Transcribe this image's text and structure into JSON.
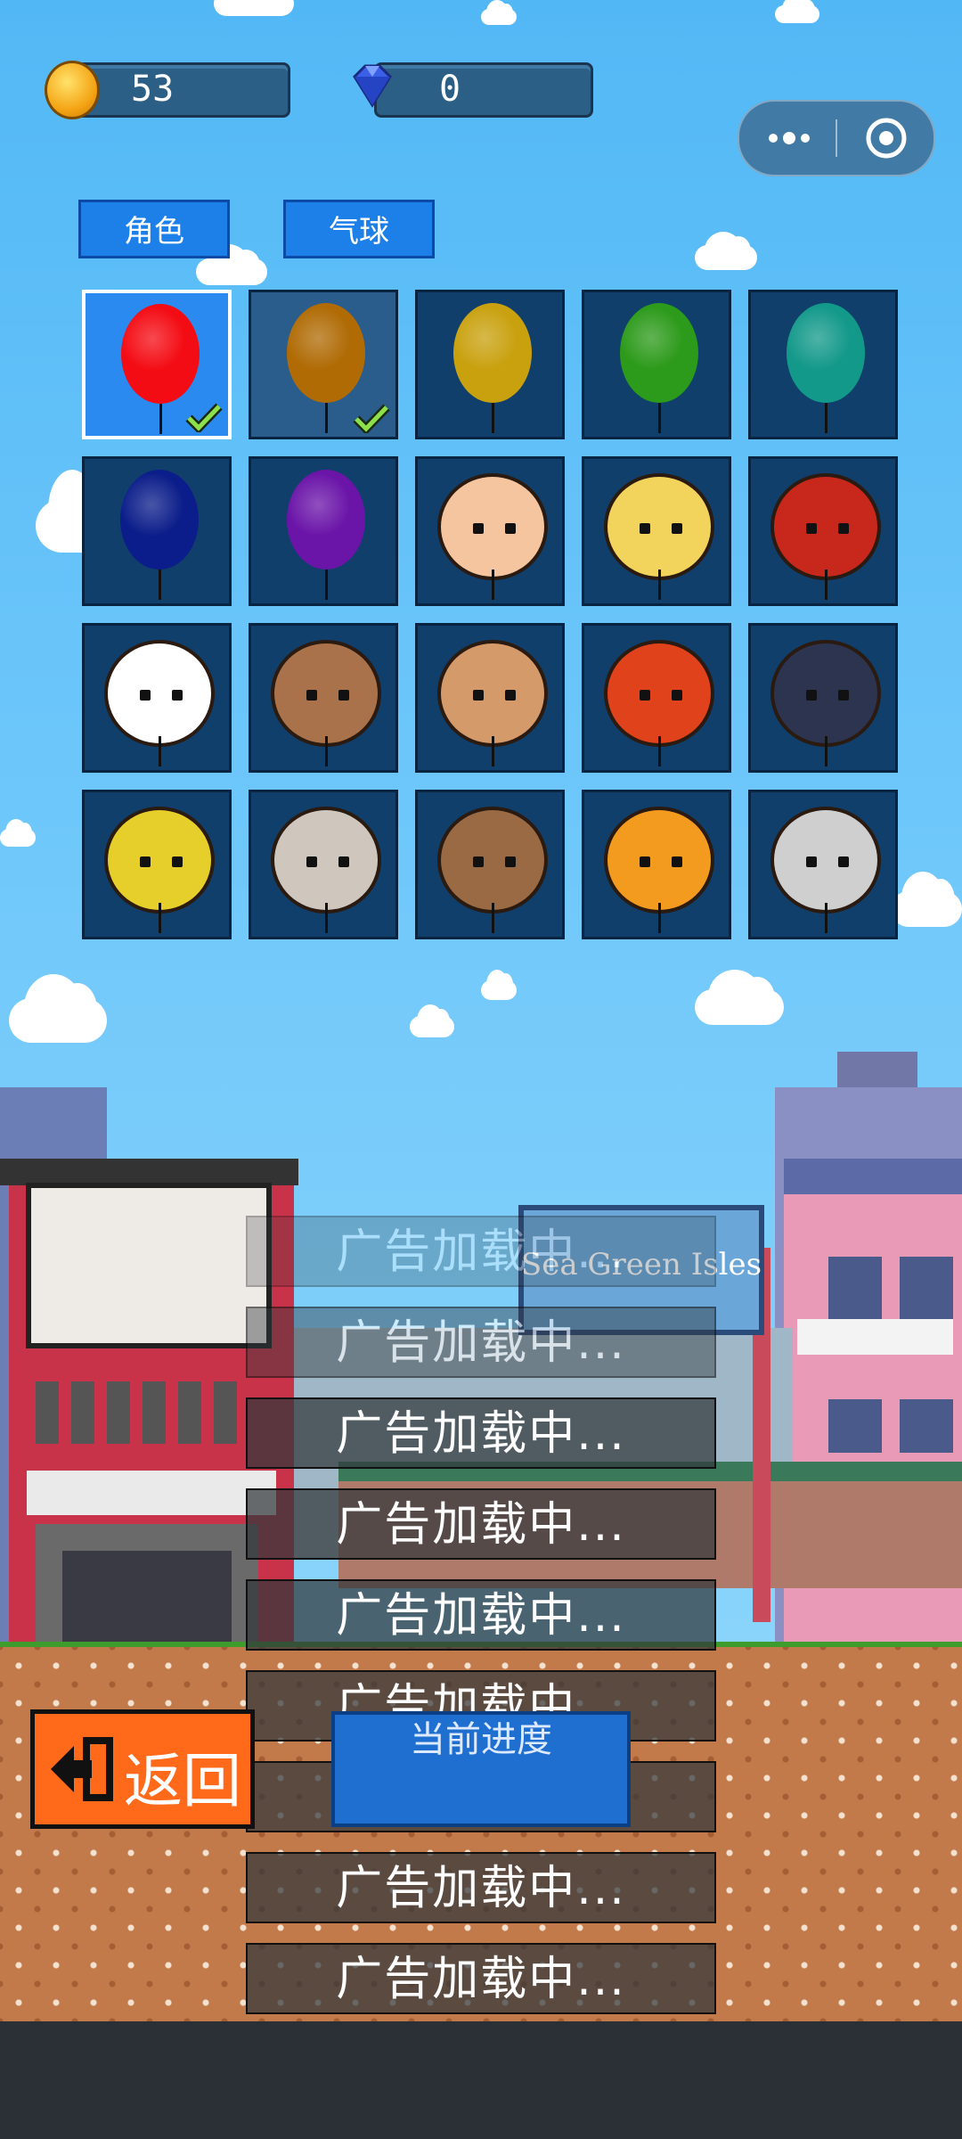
{
  "currency": {
    "coins": "53",
    "gems": "0"
  },
  "tabs": [
    {
      "label": "角色"
    },
    {
      "label": "气球"
    }
  ],
  "balloons": [
    {
      "name": "red-balloon",
      "color": "#f40c14",
      "owned": true,
      "selected": true
    },
    {
      "name": "orange-balloon",
      "color": "#b06b05",
      "owned": true,
      "selected": false
    },
    {
      "name": "yellow-balloon",
      "color": "#c9a10f",
      "owned": false
    },
    {
      "name": "green-balloon",
      "color": "#2c9a1a",
      "owned": false
    },
    {
      "name": "teal-balloon",
      "color": "#13998a",
      "owned": false
    },
    {
      "name": "navy-balloon",
      "color": "#0b1d8a",
      "owned": false
    },
    {
      "name": "purple-balloon",
      "color": "#6a14a8",
      "owned": false
    },
    {
      "name": "girl-balloon",
      "color": "#f4c59e",
      "owned": false
    },
    {
      "name": "chick-balloon",
      "color": "#f2d35c",
      "owned": false
    },
    {
      "name": "ladybug-balloon",
      "color": "#c8281c",
      "owned": false
    },
    {
      "name": "penguin-balloon",
      "color": "#ffffff",
      "owned": false
    },
    {
      "name": "bear-balloon",
      "color": "#a9724a",
      "owned": false
    },
    {
      "name": "pufferfish-balloon",
      "color": "#d59a6a",
      "owned": false
    },
    {
      "name": "goldfish-balloon",
      "color": "#e0421c",
      "owned": false
    },
    {
      "name": "mouse-balloon",
      "color": "#2c3450",
      "owned": false
    },
    {
      "name": "duck-balloon",
      "color": "#e6cf2a",
      "owned": false
    },
    {
      "name": "sheep-balloon",
      "color": "#cfc7bd",
      "owned": false
    },
    {
      "name": "cat-balloon",
      "color": "#9a6a45",
      "owned": false
    },
    {
      "name": "sunflower-balloon",
      "color": "#f29b1e",
      "owned": false
    },
    {
      "name": "gadget-balloon",
      "color": "#cfcfcf",
      "owned": false
    }
  ],
  "billboard": "Sea Green Isles",
  "ads": [
    "广告加载中...",
    "广告加载中...",
    "广告加载中...",
    "广告加载中...",
    "广告加载中...",
    "广告加载中...",
    "广告加载中...",
    "广告加载中...",
    "广告加载中..."
  ],
  "back_button": {
    "label": "返回"
  },
  "progress_button": {
    "label": "当前进度"
  }
}
